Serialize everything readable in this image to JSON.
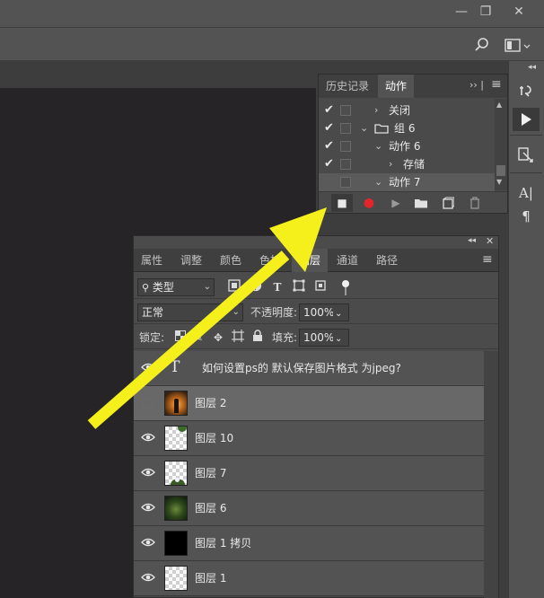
{
  "window": {
    "minimize_glyph": "—",
    "restore_glyph": "❐",
    "close_glyph": "✕"
  },
  "options_bar": {
    "search_icon": "search-icon",
    "workspace_icon": "workspace-icon"
  },
  "actions_panel": {
    "tabs": [
      {
        "label": "历史记录",
        "active": false
      },
      {
        "label": "动作",
        "active": true
      }
    ],
    "menu_glyph": "≡",
    "expand_glyph": "›› |",
    "rows": [
      {
        "checked": true,
        "indent": 1,
        "arrow": "›",
        "label": "关闭",
        "is_folder": false
      },
      {
        "checked": true,
        "indent": 0,
        "arrow": "⌄",
        "label": "组 6",
        "is_folder": true
      },
      {
        "checked": true,
        "indent": 1,
        "arrow": "⌄",
        "label": "动作 6",
        "is_folder": false
      },
      {
        "checked": true,
        "indent": 2,
        "arrow": "›",
        "label": "存储",
        "is_folder": false
      },
      {
        "checked": false,
        "indent": 1,
        "arrow": "⌄",
        "label": "动作 7",
        "is_folder": false
      }
    ],
    "bottom_buttons": [
      {
        "name": "stop-recording-button",
        "glyph": "■"
      },
      {
        "name": "record-button",
        "glyph": "●"
      },
      {
        "name": "play-button",
        "glyph": "▶"
      },
      {
        "name": "new-set-button",
        "glyph": "folder"
      },
      {
        "name": "new-action-button",
        "glyph": "⊞"
      },
      {
        "name": "delete-button",
        "glyph": "🗑"
      }
    ]
  },
  "layers_panel": {
    "tabs": [
      {
        "label": "属性",
        "active": false
      },
      {
        "label": "调整",
        "active": false
      },
      {
        "label": "颜色",
        "active": false
      },
      {
        "label": "色板",
        "active": false
      },
      {
        "label": "图层",
        "active": true
      },
      {
        "label": "通道",
        "active": false
      },
      {
        "label": "路径",
        "active": false
      }
    ],
    "filter_kind": "类型",
    "blend_mode": "正常",
    "opacity_label": "不透明度:",
    "opacity_value": "100%",
    "lock_label": "锁定:",
    "fill_label": "填充:",
    "fill_value": "100%",
    "layers": [
      {
        "name": "如何设置ps的 默认保存图片格式 为jpeg?",
        "type": "text",
        "visible": true,
        "selected": false
      },
      {
        "name": "图层 2",
        "type": "photo-sunset",
        "visible": false,
        "selected": true
      },
      {
        "name": "图层 10",
        "type": "transparent-leaf",
        "visible": true,
        "selected": false
      },
      {
        "name": "图层 7",
        "type": "transparent-flower",
        "visible": true,
        "selected": false
      },
      {
        "name": "图层 6",
        "type": "green-blur",
        "visible": true,
        "selected": false
      },
      {
        "name": "图层 1 拷贝",
        "type": "black",
        "visible": true,
        "selected": false
      },
      {
        "name": "图层 1",
        "type": "transparent",
        "visible": true,
        "selected": false
      }
    ]
  },
  "right_strip": {
    "buttons": [
      "history-brush-icon",
      "play-actions-icon",
      "clone-source-icon",
      "character-icon",
      "paragraph-icon"
    ]
  },
  "annotation": {
    "arrow_color": "#f5f01c"
  }
}
